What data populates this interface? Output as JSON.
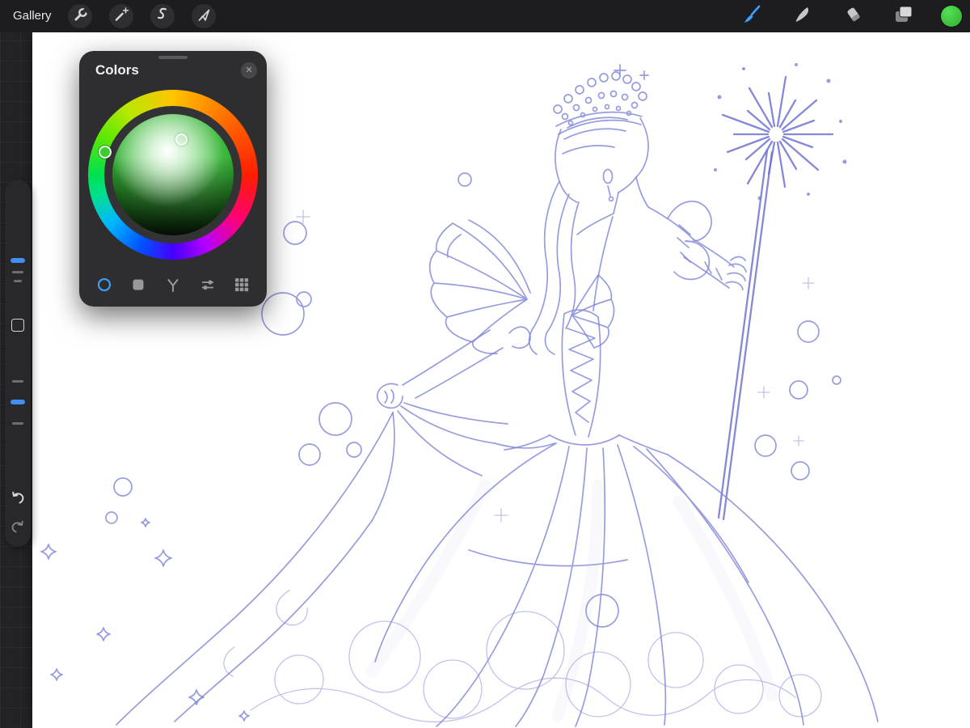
{
  "toolbar": {
    "gallery_label": "Gallery",
    "left_tools": [
      "actions-wrench",
      "adjustments-wand",
      "selection-s",
      "transform-arrow"
    ],
    "right_tools": [
      "paint-brush",
      "smudge",
      "erase",
      "layers",
      "color-swatch"
    ],
    "active_tool": "paint-brush",
    "active_tool_color": "#3aa2ff",
    "current_color": "#3bd43b"
  },
  "colors_panel": {
    "title": "Colors",
    "close_label": "✕",
    "selected_color": "#3ecb2f",
    "selected_hue": "green",
    "modes": [
      "disc",
      "classic",
      "harmony",
      "value",
      "palettes"
    ],
    "active_mode": "disc",
    "accent": "#3d9df5"
  },
  "sidebar": {
    "controls": [
      "brush-size-slider",
      "modify-button",
      "opacity-slider",
      "undo",
      "redo"
    ],
    "slider_accent": "#3f8ef0"
  },
  "canvas": {
    "background": "#ffffff",
    "sketch_ink": "#7e84d6",
    "subject": "Blue pencil sketch of a fairy godmother seen from behind: beaded crown, flowing hair, ruffled shoulder bows, laced corset back, huge swirling ball gown, raised arm holding a long wand topped with a radiating star sparkle, surrounded by floating bubbles and star sparkles"
  }
}
